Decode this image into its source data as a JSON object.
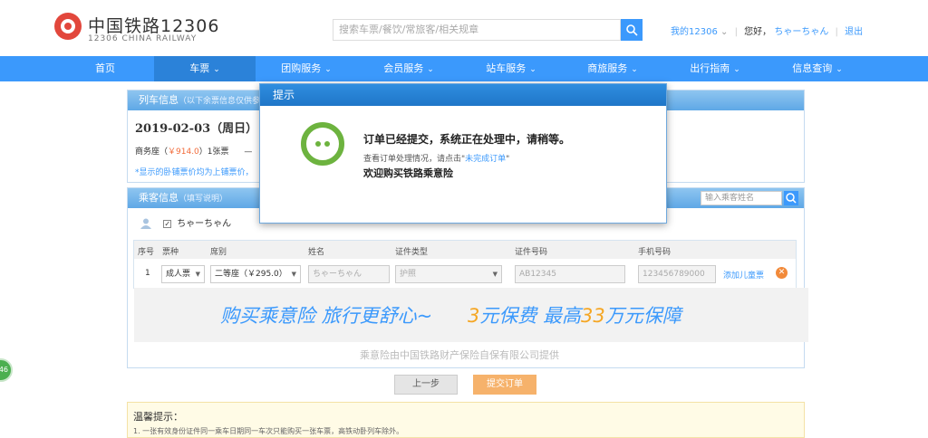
{
  "header": {
    "logo_cn": "中国铁路12306",
    "logo_en": "12306 CHINA RAILWAY",
    "search_placeholder": "搜索车票/餐饮/常旅客/相关规章",
    "my_account": "我的12306",
    "greeting": "您好，",
    "username": "ちゃーちゃん",
    "logout": "退出"
  },
  "nav": {
    "items": [
      {
        "label": "首页",
        "chev": ""
      },
      {
        "label": "车票",
        "chev": "⌄"
      },
      {
        "label": "团购服务",
        "chev": "⌄"
      },
      {
        "label": "会员服务",
        "chev": "⌄"
      },
      {
        "label": "站车服务",
        "chev": "⌄"
      },
      {
        "label": "商旅服务",
        "chev": "⌄"
      },
      {
        "label": "出行指南",
        "chev": "⌄"
      },
      {
        "label": "信息查询",
        "chev": "⌄"
      }
    ]
  },
  "train_panel": {
    "title": "列车信息",
    "title_sub": "（以下余票信息仅供参考）",
    "date": "2019-02-03（周日） G",
    "seat_label": "商务座（",
    "seat_price": "￥914.0",
    "seat_tail": "）1张票",
    "seat_more": "—",
    "note": "*显示的卧铺票价均为上铺票价，"
  },
  "passenger_panel": {
    "title": "乘客信息",
    "title_sub": "（填写说明）",
    "search_placeholder": "输入乘客姓名",
    "user_name": "ちゃーちゃん",
    "columns": {
      "no": "序号",
      "type": "票种",
      "seat": "席别",
      "name": "姓名",
      "id_type": "证件类型",
      "id_no": "证件号码",
      "phone": "手机号码"
    },
    "row": {
      "no": "1",
      "type": "成人票",
      "seat": "二等座（￥295.0）",
      "name": "ちゃーちゃん",
      "id_type": "护照",
      "id_no": "AB12345",
      "phone": "123456789000",
      "add_child": "添加儿童票"
    },
    "banner_left": "购买乘意险  旅行更舒心~",
    "banner_price_a": "3",
    "banner_price_b": "元保费  最高",
    "banner_price_c": "33",
    "banner_price_d": "万元保障",
    "banner_provider": "乘意险由中国铁路财产保险自保有限公司提供"
  },
  "buttons": {
    "prev": "上一步",
    "submit": "提交订单"
  },
  "tip": {
    "title": "温馨提示：",
    "text": "1. 一张有效身份证件同一乘车日期同一车次只能购买一张车票，高铁动卧列车除外。"
  },
  "side_badge": "46",
  "modal": {
    "title": "提示",
    "message": "订单已经提交，系统正在处理中，请稍等。",
    "detail_prefix": "查看订单处理情况，请点击\"",
    "detail_link": "未完成订单",
    "detail_suffix": "\"",
    "insurance": "欢迎购买铁路乘意险"
  },
  "colors": {
    "accent": "#3b99fc",
    "modal_header": "#1f76c8",
    "loading_green": "#6db33f",
    "price_orange": "#f26b3a",
    "submit_orange": "#f6b26b"
  }
}
